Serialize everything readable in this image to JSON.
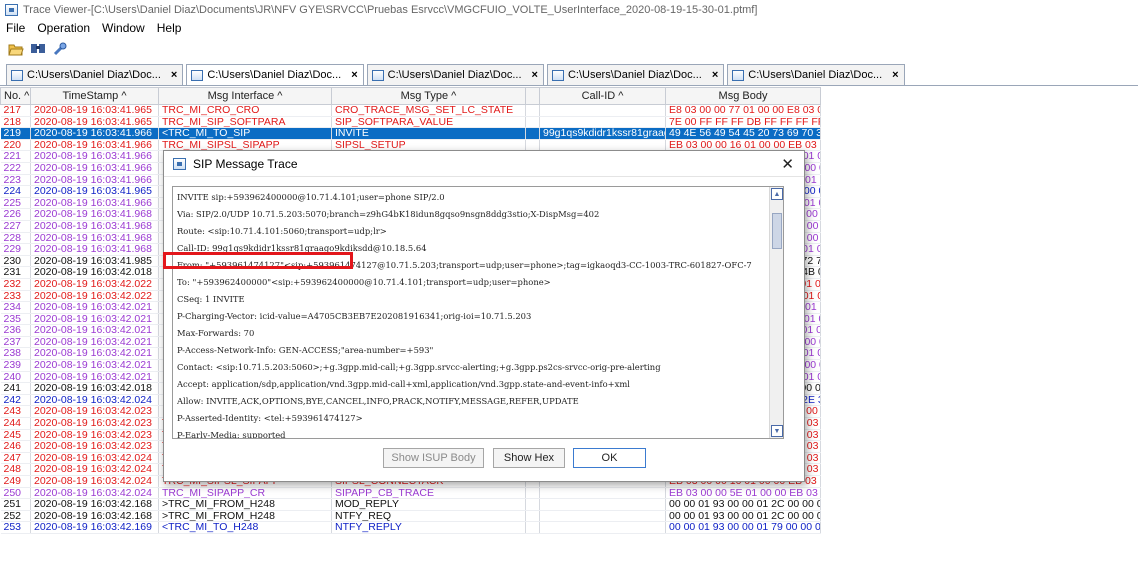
{
  "window": {
    "title": "Trace Viewer-[C:\\Users\\Daniel Diaz\\Documents\\JR\\NFV GYE\\SRVCC\\Pruebas Esrvcc\\VMGCFUIO_VOLTE_UserInterface_2020-08-19-15-30-01.ptmf]"
  },
  "menu": [
    "File",
    "Operation",
    "Window",
    "Help"
  ],
  "toolbar": [
    "open-icon",
    "find-icon",
    "settings-icon"
  ],
  "tabs": [
    {
      "label": "C:\\Users\\Daniel Diaz\\Doc...",
      "close": "×"
    },
    {
      "label": "C:\\Users\\Daniel Diaz\\Doc...",
      "close": "×"
    },
    {
      "label": "C:\\Users\\Daniel Diaz\\Doc...",
      "close": "×"
    },
    {
      "label": "C:\\Users\\Daniel Diaz\\Doc...",
      "close": "×"
    },
    {
      "label": "C:\\Users\\Daniel Diaz\\Doc...",
      "close": "×"
    }
  ],
  "table": {
    "columns": [
      "No. ^",
      "TimeStamp ^",
      "Msg Interface ^",
      "Msg Type ^",
      "",
      "Call-ID ^",
      "Msg Body"
    ],
    "rows": [
      {
        "c": "red",
        "no": "217",
        "ts": "2020-08-19 16:03:41.965",
        "iface": "TRC_MI_CRO_CRO",
        "type": "CRO_TRACE_MSG_SET_LC_STATE",
        "call": "",
        "body": "E8 03 00 00 77 01 00 00 E8 03 00 00 77 01 00 00 79..."
      },
      {
        "c": "red",
        "no": "218",
        "ts": "2020-08-19 16:03:41.965",
        "iface": "TRC_MI_SIP_SOFTPARA",
        "type": "SIP_SOFTPARA_VALUE",
        "call": "",
        "body": "7E 00 FF FF FF DB FF FF FF FF FB FF FF FF FF F..."
      },
      {
        "c": "sel",
        "no": "219",
        "ts": "2020-08-19 16:03:41.966",
        "iface": "<TRC_MI_TO_SIP",
        "type": "INVITE",
        "call": "99g1qs9kdidr1kssr81graago9...",
        "body": "49 4E 56 49 54 45 20 73 69 70 3A 2B 35 39 33 39 3..."
      },
      {
        "c": "red",
        "no": "220",
        "ts": "2020-08-19 16:03:41.966",
        "iface": "TRC_MI_SIPSL_SIPAPP",
        "type": "SIPSL_SETUP",
        "call": "",
        "body": "EB 03 00 00 16 01 00 00 EB 03 00 00 5E 01 00 00 1..."
      },
      {
        "c": "purple",
        "no": "221",
        "ts": "2020-08-19 16:03:41.966",
        "iface": "",
        "type": "",
        "call": "",
        "body": "16 01 00 00 EB 03 00 00 16 01 00 00 3..."
      },
      {
        "c": "purple",
        "no": "222",
        "ts": "2020-08-19 16:03:41.966",
        "iface": "",
        "type": "",
        "call": "",
        "body": "16 01 00 00 EB 03 00 00 D1 00 00 00 0..."
      },
      {
        "c": "purple",
        "no": "223",
        "ts": "2020-08-19 16:03:41.966",
        "iface": "",
        "type": "",
        "call": "",
        "body": "5E 01 00 00 EB 03 00 00 5E 01 00 00 9..."
      },
      {
        "c": "blue",
        "no": "224",
        "ts": "2020-08-19 16:03:41.965",
        "iface": "",
        "type": "",
        "call": "",
        "body": "64 01 00 00 95 01 00 00 CC 00 00 00 3..."
      },
      {
        "c": "purple",
        "no": "225",
        "ts": "2020-08-19 16:03:41.966",
        "iface": "",
        "type": "",
        "call": "",
        "body": "5E 01 00 00 EB 03 00 00 16 01 00 00 0..."
      },
      {
        "c": "purple",
        "no": "226",
        "ts": "2020-08-19 16:03:41.968",
        "iface": "",
        "type": "",
        "call": "",
        "body": "D1 00 00 00 EB 03 00 00 D3 00 00 00 0..."
      },
      {
        "c": "purple",
        "no": "227",
        "ts": "2020-08-19 16:03:41.968",
        "iface": "",
        "type": "",
        "call": "",
        "body": "D3 00 00 00 EB 03 00 00 DF 00 00 00 0..."
      },
      {
        "c": "purple",
        "no": "228",
        "ts": "2020-08-19 16:03:41.968",
        "iface": "",
        "type": "",
        "call": "",
        "body": "DF 00 00 00 EB 03 00 00 D9 00 00 00 0..."
      },
      {
        "c": "purple",
        "no": "229",
        "ts": "2020-08-19 16:03:41.968",
        "iface": "",
        "type": "",
        "call": "",
        "body": "D9 00 00 00 95 01 00 00 64 01 00 00 3..."
      },
      {
        "c": "black",
        "no": "230",
        "ts": "2020-08-19 16:03:41.985",
        "iface": "",
        "type": "",
        "call": "",
        "body": "32 2E 30 20 31 30 30 20 54 72 79 69 6E..."
      },
      {
        "c": "black",
        "no": "231",
        "ts": "2020-08-19 16:03:42.018",
        "iface": "",
        "type": "",
        "call": "",
        "body": "32 2E 30 20 32 30 30 20 4F 4B 0D 0A 5..."
      },
      {
        "c": "red",
        "no": "232",
        "ts": "2020-08-19 16:03:42.022",
        "iface": "",
        "type": "",
        "call": "",
        "body": "77 01 00 00 93 01 00 00 79 01 00 00 FB..."
      },
      {
        "c": "red",
        "no": "233",
        "ts": "2020-08-19 16:03:42.022",
        "iface": "",
        "type": "",
        "call": "",
        "body": "77 01 00 00 EB 03 00 00 77 01 00 00 79..."
      },
      {
        "c": "purple",
        "no": "234",
        "ts": "2020-08-19 16:03:42.021",
        "iface": "",
        "type": "",
        "call": "",
        "body": "5E 01 00 00 EB 03 00 00 5E 01 00 00 9..."
      },
      {
        "c": "purple",
        "no": "235",
        "ts": "2020-08-19 16:03:42.021",
        "iface": "",
        "type": "",
        "call": "",
        "body": "5E 01 00 00 EB 03 00 00 16 01 00 00 F..."
      },
      {
        "c": "purple",
        "no": "236",
        "ts": "2020-08-19 16:03:42.021",
        "iface": "",
        "type": "",
        "call": "",
        "body": "16 01 00 00 E8 03 00 00 77 01 00 00 C..."
      },
      {
        "c": "purple",
        "no": "237",
        "ts": "2020-08-19 16:03:42.021",
        "iface": "",
        "type": "",
        "call": "",
        "body": "16 01 00 00 EB 03 00 00 D1 00 00 00 5..."
      },
      {
        "c": "purple",
        "no": "238",
        "ts": "2020-08-19 16:03:42.021",
        "iface": "",
        "type": "",
        "call": "",
        "body": "16 01 00 00 EB 03 00 00 16 01 00 00 3..."
      },
      {
        "c": "purple",
        "no": "239",
        "ts": "2020-08-19 16:03:42.021",
        "iface": "",
        "type": "",
        "call": "",
        "body": "16 01 00 00 EB 03 00 00 D1 00 00 00 8..."
      },
      {
        "c": "purple",
        "no": "240",
        "ts": "2020-08-19 16:03:42.021",
        "iface": "",
        "type": "",
        "call": "",
        "body": "16 01 00 00 EB 03 00 00 16 01 00 00 3..."
      },
      {
        "c": "black",
        "no": "241",
        "ts": "2020-08-19 16:03:42.018",
        "iface": "",
        "type": "",
        "call": "",
        "body": "00 00 01 79 00 00 01 93 00 00 01 2C 00..."
      },
      {
        "c": "blue",
        "no": "242",
        "ts": "2020-08-19 16:03:42.024",
        "iface": "",
        "type": "",
        "call": "",
        "body": "73 69 70 3A 31 30 2E 37 31 2E 34 2E 3..."
      },
      {
        "c": "red",
        "no": "243",
        "ts": "2020-08-19 16:03:42.023",
        "iface": "",
        "type": "",
        "call": "",
        "body": "D1 00 00 00 EB 03 00 00 D3 00 00 00 5..."
      },
      {
        "c": "red",
        "no": "244",
        "ts": "2020-08-19 16:03:42.023",
        "iface": "TRC_MI_MCCB_CM",
        "type": "MCCB_CM_CONNECT",
        "call": "",
        "body": "EB 03 00 00 D1 00 00 00 EB 03 00 00 D3 00 00 00 6..."
      },
      {
        "c": "red",
        "no": "245",
        "ts": "2020-08-19 16:03:42.023",
        "iface": "TRC_MI_CM_CCB",
        "type": "CM_CCB_BEARER_INFO",
        "call": "",
        "body": "EB 03 00 00 D3 00 00 00 EB 03 00 00 D1 00 00 00 0..."
      },
      {
        "c": "red",
        "no": "246",
        "ts": "2020-08-19 16:03:42.023",
        "iface": "TRC_MI_CM_CCB",
        "type": "CM_CCB_CONNECT_ACKNOWLEDGE",
        "call": "",
        "body": "EB 03 00 00 D3 00 00 00 EB 03 00 00 D1 00 00 00 3..."
      },
      {
        "c": "red",
        "no": "247",
        "ts": "2020-08-19 16:03:42.024",
        "iface": "TRC_MI_MCCB_SIP",
        "type": "MCCB_SIP_BEARER_INFO",
        "call": "",
        "body": "EB 03 00 00 D1 00 00 00 EB 03 00 00 16 01 00 00 0..."
      },
      {
        "c": "red",
        "no": "248",
        "ts": "2020-08-19 16:03:42.024",
        "iface": "TRC_MI_MCCB_SIP",
        "type": "MCCB_SIP_CONNECT_ACKNOWLEDGE",
        "call": "",
        "body": "EB 03 00 00 D1 00 00 00 EB 03 00 00 16 01 00 00 3..."
      },
      {
        "c": "red",
        "no": "249",
        "ts": "2020-08-19 16:03:42.024",
        "iface": "TRC_MI_SIPSL_SIPAPP",
        "type": "SIPSL_CONNECTACK",
        "call": "",
        "body": "EB 03 00 00 16 01 00 00 EB 03 00 00 5E 01 00 00 0..."
      },
      {
        "c": "purple",
        "no": "250",
        "ts": "2020-08-19 16:03:42.024",
        "iface": "TRC_MI_SIPAPP_CR",
        "type": "SIPAPP_CB_TRACE",
        "call": "",
        "body": "EB 03 00 00 5E 01 00 00 EB 03 00 00 5E 01 00 00 0..."
      },
      {
        "c": "black",
        "no": "251",
        "ts": "2020-08-19 16:03:42.168",
        "iface": ">TRC_MI_FROM_H248",
        "type": "MOD_REPLY",
        "call": "",
        "body": "00 00 01 93 00 00 01 2C 00 00 01 93 00 00 01 79 00..."
      },
      {
        "c": "black",
        "no": "252",
        "ts": "2020-08-19 16:03:42.168",
        "iface": ">TRC_MI_FROM_H248",
        "type": "NTFY_REQ",
        "call": "",
        "body": "00 00 01 93 00 00 01 2C 00 00 01 93 00 00 01 79 00..."
      },
      {
        "c": "blue",
        "no": "253",
        "ts": "2020-08-19 16:03:42.169",
        "iface": "<TRC_MI_TO_H248",
        "type": "NTFY_REPLY",
        "call": "",
        "body": "00 00 01 93 00 00 01 79 00 00 01 93 00 00 01 2C 00..."
      }
    ]
  },
  "dialog": {
    "title": "SIP Message Trace",
    "close": "✕",
    "lines": [
      "INVITE sip:+593962400000@10.71.4.101;user=phone SIP/2.0",
      "Via: SIP/2.0/UDP 10.71.5.203:5070;branch=z9hG4bK18idun8gqso9nsgn8ddg3stio;X-DispMsg=402",
      "Route: <sip:10.71.4.101:5060;transport=udp;lr>",
      "Call-ID: 99g1qs9kdidr1kssr81graago9kdiksdd@10.18.5.64",
      "From: \"+593961474127\"<sip:+593961474127@10.71.5.203;transport=udp;user=phone>;tag=igkaoqd3-CC-1003-TRC-601827-OFC-7",
      "To: \"+593962400000\"<sip:+593962400000@10.71.4.101;transport=udp;user=phone>",
      "CSeq: 1 INVITE",
      "P-Charging-Vector: icid-value=A4705CB3EB7E202081916341;orig-ioi=10.71.5.203",
      "Max-Forwards: 70",
      "P-Access-Network-Info: GEN-ACCESS;\"area-number=+593\"",
      "Contact: <sip:10.71.5.203:5060>;+g.3gpp.mid-call;+g.3gpp.srvcc-alerting;+g.3gpp.ps2cs-srvcc-orig-pre-alerting",
      "Accept: application/sdp,application/vnd.3gpp.mid-call+xml,application/vnd.3gpp.state-and-event-info+xml",
      "Allow: INVITE,ACK,OPTIONS,BYE,CANCEL,INFO,PRACK,NOTIFY,MESSAGE,REFER,UPDATE",
      "P-Asserted-Identity: <tel:+593961474127>",
      "P-Early-Media: supported"
    ],
    "buttons": {
      "isup": "Show ISUP Body",
      "hex": "Show Hex",
      "ok": "OK"
    }
  },
  "colors": {
    "selected": "#0b6cc4",
    "red": "#e11919",
    "purple": "#9b3ad2",
    "blue": "#0d1fc6",
    "highlight": "#e3161b"
  }
}
